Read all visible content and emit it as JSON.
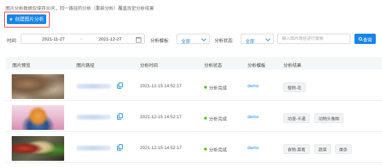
{
  "notice": "图片分析数据仅保存30天，同一路径的分析（重新分析）覆盖历史分析结果",
  "create_button": {
    "icon": "plus-icon",
    "label": "创建图片分析"
  },
  "filters": {
    "time_label": "时间:",
    "start_date": "2021-11-27",
    "separator": "~",
    "end_date": "2021-12-27",
    "model_label": "分析模板:",
    "model_value": "全部",
    "status_label": "分析状态:",
    "status_value": "全部",
    "search_placeholder": "输入图片路径进行搜索",
    "search_button": "查询"
  },
  "table": {
    "columns": [
      "图片预览",
      "图片路径",
      "分析时间",
      "分析状态",
      "分析模板",
      "分析结果"
    ],
    "rows": [
      {
        "time": "2021-12-15 14:52:17",
        "status": "分析完成",
        "model": "demo",
        "tags": [
          "植物-花"
        ]
      },
      {
        "time": "2021-12-15 14:52:17",
        "status": "分析完成",
        "model": "demo",
        "tags": [
          "动漫-卡通",
          "动物头像图"
        ]
      },
      {
        "time": "2021-12-15 14:52:17",
        "status": "分析完成",
        "model": "demo",
        "tags": [
          "食物-菜肴",
          "蔬菜",
          "面条"
        ]
      }
    ]
  },
  "colors": {
    "accent": "#1785e6",
    "highlight_border": "#e5393a",
    "success": "#52c41a"
  }
}
